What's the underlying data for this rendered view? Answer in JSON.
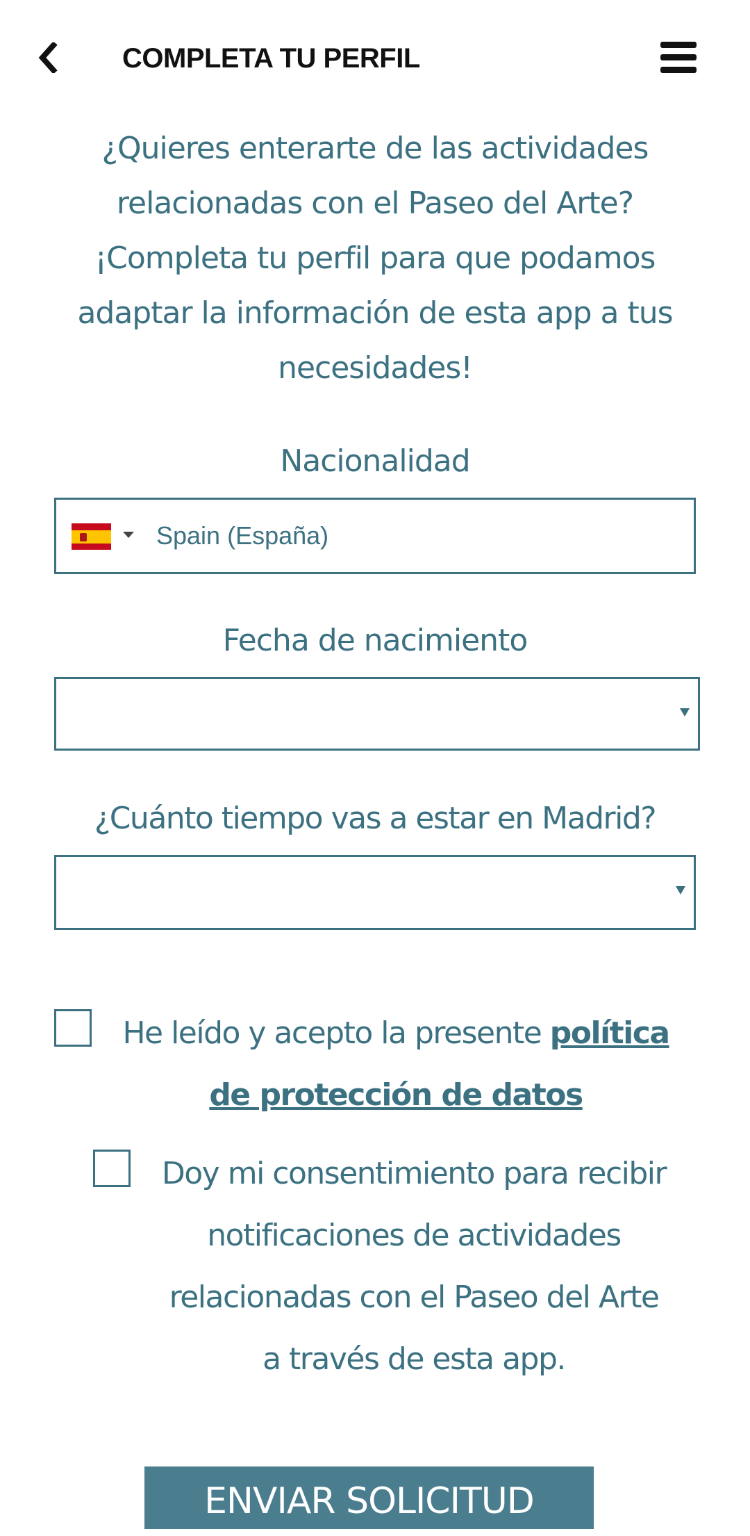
{
  "header": {
    "title": "COMPLETA TU PERFIL",
    "back_icon": "chevron-left-icon",
    "menu_icon": "hamburger-menu-icon"
  },
  "intro": {
    "text": "¿Quieres enterarte de las actividades relacionadas con el Paseo del Arte? ¡Completa tu perfil para que podamos adaptar la información de esta app a tus necesidades!"
  },
  "form": {
    "nationality": {
      "label": "Nacionalidad",
      "value": "Spain (España)",
      "flag_icon": "spain-flag-icon"
    },
    "birthdate": {
      "label": "Fecha de nacimiento",
      "value": ""
    },
    "stay_duration": {
      "label": "¿Cuánto tiempo vas a estar en Madrid?",
      "value": ""
    },
    "privacy_consent": {
      "text": "He leído y acepto la presente ",
      "link": "política de protección de datos",
      "checked": false
    },
    "notifications_consent": {
      "text": "Doy mi consentimiento para recibir notificaciones de actividades relacionadas con el Paseo del Arte a través de esta app.",
      "checked": false
    },
    "submit_label": "ENVIAR SOLICITUD"
  },
  "colors": {
    "accent": "#3c7182",
    "button_bg": "#4a7d8e",
    "title": "#111111"
  }
}
